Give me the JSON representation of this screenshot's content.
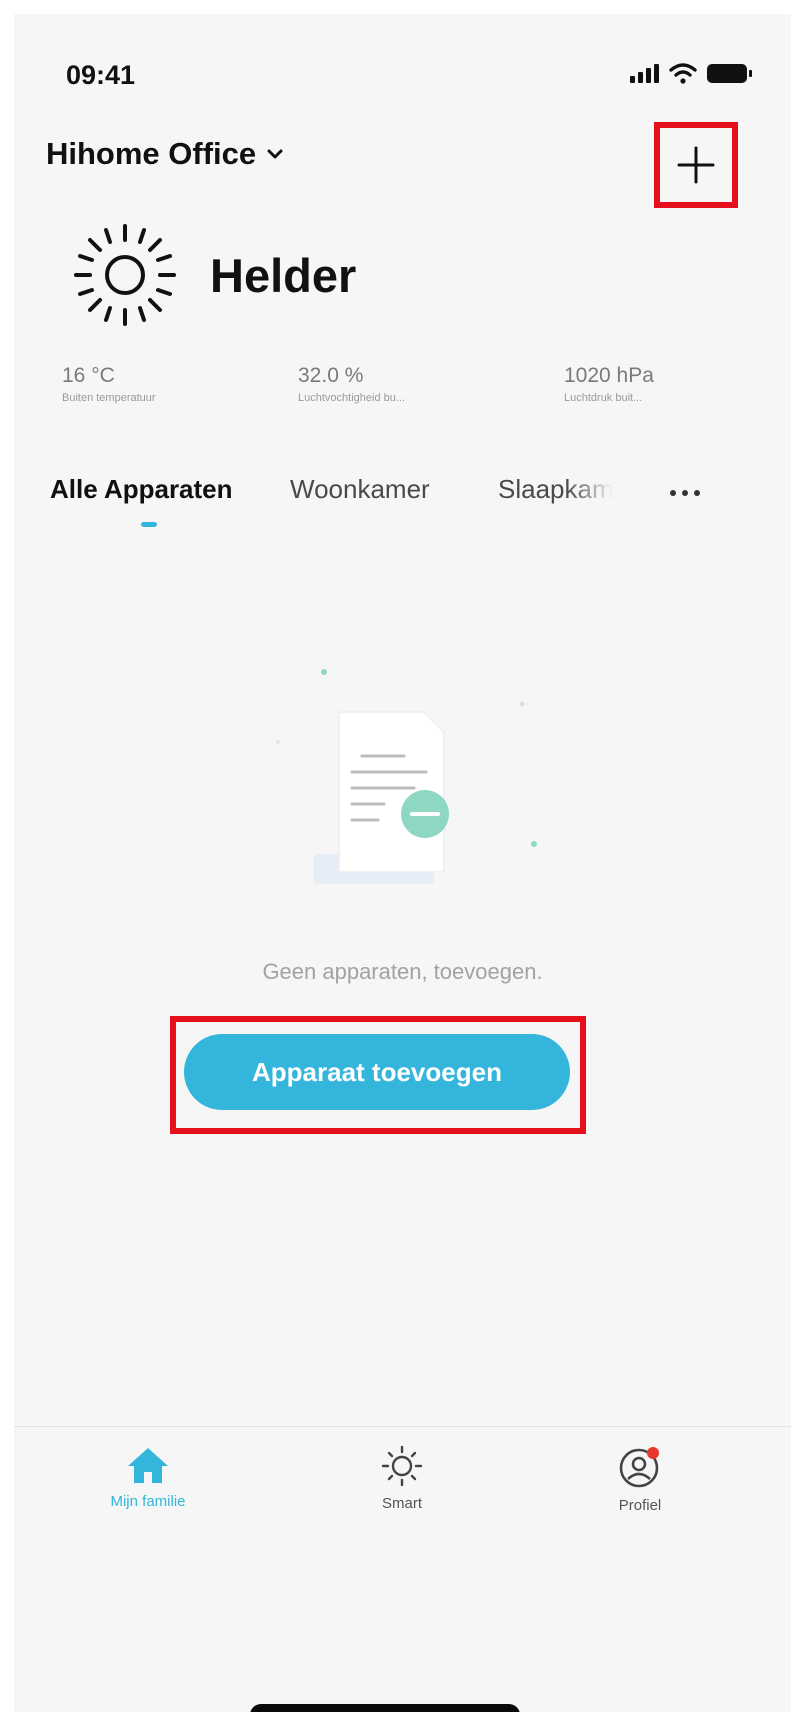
{
  "status_bar": {
    "time": "09:41"
  },
  "header": {
    "home_name": "Hihome Office",
    "icons": [
      "chevron-down-icon",
      "plus-icon"
    ]
  },
  "weather": {
    "condition": "Helder",
    "icon": "sun-icon",
    "stats": [
      {
        "value": "16 °C",
        "label": "Buiten temperatuur"
      },
      {
        "value": "32.0 %",
        "label": "Luchtvochtigheid bu..."
      },
      {
        "value": "1020 hPa",
        "label": "Luchtdruk buit..."
      }
    ]
  },
  "tabs": [
    "Alle Apparaten",
    "Woonkamer",
    "Slaapkamer"
  ],
  "empty_state": {
    "message": "Geen apparaten, toevoegen.",
    "button_label": "Apparaat toevoegen"
  },
  "bottom_nav": [
    {
      "label": "Mijn familie",
      "icon": "home-icon",
      "active": true
    },
    {
      "label": "Smart",
      "icon": "sun-icon",
      "active": false
    },
    {
      "label": "Profiel",
      "icon": "profile-icon",
      "active": false
    }
  ],
  "colors": {
    "accent": "#34b6dc",
    "highlight": "#e5101c",
    "badge": "#e8382c"
  }
}
